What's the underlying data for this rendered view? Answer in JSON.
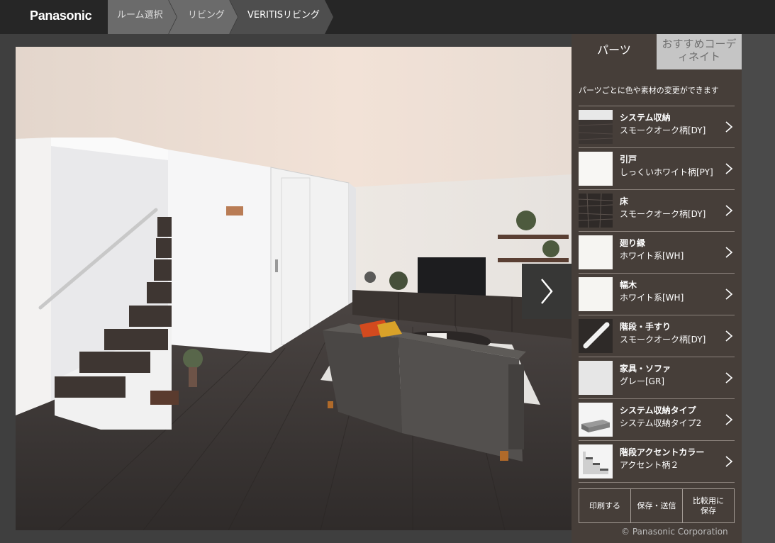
{
  "header": {
    "logo": "Panasonic",
    "breadcrumbs": [
      {
        "label": "ルーム選択"
      },
      {
        "label": "リビング"
      },
      {
        "label": "VERITISリビング"
      }
    ]
  },
  "panel": {
    "tab_parts": "パーツ",
    "tab_recommend": "おすすめコーディネイト",
    "description": "パーツごとに色や素材の変更ができます",
    "items": [
      {
        "name": "システム収納",
        "value": "スモークオーク柄[DY]",
        "icon": "dark-wood-swatch"
      },
      {
        "name": "引戸",
        "value": "しっくいホワイト柄[PY]",
        "icon": "white-swatch"
      },
      {
        "name": "床",
        "value": "スモークオーク柄[DY]",
        "icon": "dark-wood-swatch"
      },
      {
        "name": "廻り縁",
        "value": "ホワイト系[WH]",
        "icon": "white-swatch"
      },
      {
        "name": "幅木",
        "value": "ホワイト系[WH]",
        "icon": "white-swatch"
      },
      {
        "name": "階段・手すり",
        "value": "スモークオーク柄[DY]",
        "icon": "handrail-swatch"
      },
      {
        "name": "家具・ソファ",
        "value": "グレー[GR]",
        "icon": "light-gray-swatch"
      },
      {
        "name": "システム収納タイプ",
        "value": "システム収納タイプ2",
        "icon": "storage-type-swatch"
      },
      {
        "name": "階段アクセントカラー",
        "value": "アクセント柄２",
        "icon": "stair-accent-swatch"
      }
    ],
    "actions": {
      "print": "印刷する",
      "save_send": "保存・送信",
      "compare_save": "比較用に保存"
    },
    "copyright": "© Panasonic Corporation"
  },
  "colors": {
    "header_bg": "#262626",
    "crumb_bg": "#6b6b6b",
    "crumb_active_bg": "#4e4e4e",
    "panel_bg": "#463e38",
    "floor": "#3b3735",
    "sofa": "#4a4745"
  }
}
